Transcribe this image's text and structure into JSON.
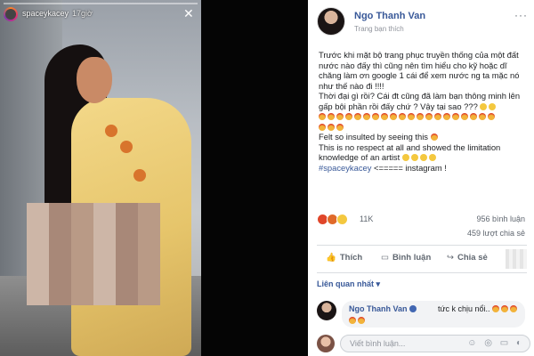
{
  "story": {
    "username": "spaceykacey",
    "time": "17giờ",
    "close_icon": "✕"
  },
  "post": {
    "author": "Ngo Thanh Van",
    "subtitle": "Trang bạn thích",
    "more_icon": "···",
    "body_lines": [
      "Trước khi mặt bộ trang phục truyền thống của một đất nước nào đấy thì cũng nên tìm hiểu cho kỹ hoặc dĩ chăng làm ơn google 1 cái để xem nước ng ta mặc nó như thế nào đi !!!!",
      "Thời đại gì rồi? Cái đt cũng đã làm bạn thông minh lên gấp bội phần rồi đấy chứ ? Vậy tại sao ???",
      "Felt so insulted by seeing this",
      "This is no respect at all and showed the limitation knowledge of an artist",
      "#spaceykacey",
      "<===== instagram !"
    ],
    "reaction_count": "11K",
    "comments_count": "956 bình luận",
    "shares_count": "459 lượt chia sẻ",
    "actions": {
      "like": "Thích",
      "comment": "Bình luận",
      "share": "Chia sẻ"
    },
    "sort_label": "Liên quan nhất ▾",
    "comment": {
      "author": "Ngo Thanh Van",
      "text": "tức k chịu nổi.."
    },
    "write_placeholder": "Viết bình luận...",
    "write_icons": "☺ ◎ ▭ ◐"
  },
  "colors": {
    "link": "#385898",
    "muted": "#606770",
    "angry": "#e0462a",
    "sad": "#f4c83f"
  }
}
